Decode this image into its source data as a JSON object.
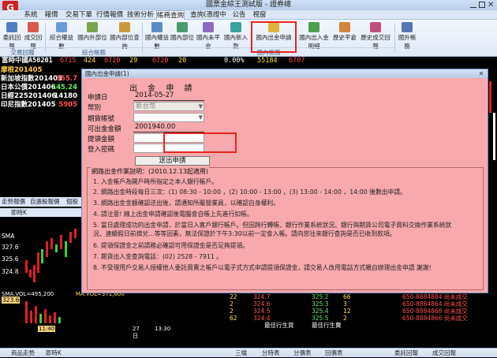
{
  "window": {
    "title": "國票金綜王測試版 - 證券總"
  },
  "menu": {
    "tabs": [
      "系統",
      "報價",
      "交易下單",
      "行情報價",
      "技術分析",
      "帳務查詢",
      "查詢(憑證中心)",
      "公告",
      "視窗"
    ]
  },
  "ribbon": {
    "buttons": [
      "委託回報",
      "成交回報",
      "綜合權益數",
      "國內外部位",
      "國內部位查詢",
      "國內權益數",
      "國內部位",
      "國內未平倉",
      "國內新入款",
      "國內出金申請",
      "國內出入金明細",
      "歷史平倉",
      "歷史成交回報",
      "國外帳務"
    ],
    "groups": [
      "交易回報",
      "綜合帳務",
      "國內帳務"
    ]
  },
  "quote_strip": {
    "symbol": "富時中國A50201",
    "values": [
      "6715",
      "424",
      "6720",
      "29",
      "6720",
      "20",
      "0.00%",
      "55184",
      "6707"
    ]
  },
  "left_panel": {
    "rows": [
      {
        "name": "摩根201405",
        "value": ""
      },
      {
        "name": "新加坡指數201405",
        "value": "355.7"
      },
      {
        "name": "日本公債201406",
        "value": "145.24"
      },
      {
        "name": "日經225201406",
        "value": "14180"
      },
      {
        "name": "印尼指數201405",
        "value": "5905"
      }
    ]
  },
  "dialog": {
    "title": "國內出金申請(1)",
    "heading": "出 金 申 請",
    "fields": {
      "apply_date_label": "申請日",
      "apply_date": "2014-05-27",
      "currency_label": "幣別",
      "currency": "新台幣",
      "futures_account_label": "期貨帳號",
      "futures_account": "",
      "available_label": "可出金金額",
      "available": "2001940.00",
      "amount_label": "提領金額",
      "amount": "",
      "password_label": "登入密碼",
      "password": ""
    },
    "submit_label": "送出申請",
    "notes_title": "網路出金作業說明：(2010.12.13起適用)",
    "notes": [
      "1. 入金帳戶為開戶時所指定之本人銀行帳戶。",
      "2. 網路出金時段每日三次：(1) 08:30 - 10:00 ，(2) 10:00 - 13:00 ，(3) 13:00 - 14:00 ，14:00 後數出申請。",
      "3. 網路出金金額確認送出後，請通知所屬營業員，以確認自身權利。",
      "4. 請注意! 線上出金申請確認後電腦會自帳上先進行扣帳。",
      "5. 當日處理成功的出金申請，於當日入客戶銀行帳戶。但因跨行轉帳、銀行作業系統狀況、銀行與期貨公司電子資料交換作業系統狀",
      "   況、連續假日前擠兌...等等因素，無法保證於下午3:30以前一定會入帳。請向您往來銀行查詢是否已收到款項。",
      "6. 提領保證金之前請務必確認可用保證金是否足夠提領。",
      "7. 期貨出入金查詢電話：(02) 2528 - 7911 。",
      "8. 不受理用戶交易人授權他人委託買賣之帳戶以電子式方式申請提領保證金，請交易人改用電話方式親自辦理出金申請 謝謝!"
    ]
  },
  "chart": {
    "pane_tabs": [
      "走勢報價",
      "自選股報價",
      "個股"
    ],
    "header": "即時K",
    "prices": [
      "327.6",
      "325.6",
      "324.8",
      "323.6"
    ],
    "sma_label": "SMA",
    "vol_label": "SMA.VOL=495,200",
    "vol_label2": "MA.VOL=371,600",
    "time_labels": [
      "11:40",
      "27日",
      "13:30"
    ]
  },
  "lower_table": {
    "rows": [
      {
        "a": "22",
        "b": "324.7",
        "c": "325.2",
        "d": "66"
      },
      {
        "a": "2",
        "b": "324.6",
        "c": "325.3",
        "d": "3"
      },
      {
        "a": "2",
        "b": "324.5",
        "c": "325.4",
        "d": "12"
      },
      {
        "a": "62",
        "b": "324.4",
        "c": "325.5",
        "d": "2"
      }
    ],
    "footer": [
      "最佳行生買",
      "最佳行生賣"
    ],
    "side": [
      "650-8884884 尚未成交",
      "650-8884864 尚未成交",
      "650-8884868 尚未成交",
      "650-8884866 尚未成交"
    ]
  },
  "bottom_tabs": [
    "商品走勢",
    "即時K",
    "三檔",
    "分時表",
    "分價表",
    "回價表",
    "委託回報",
    "成交回報"
  ]
}
